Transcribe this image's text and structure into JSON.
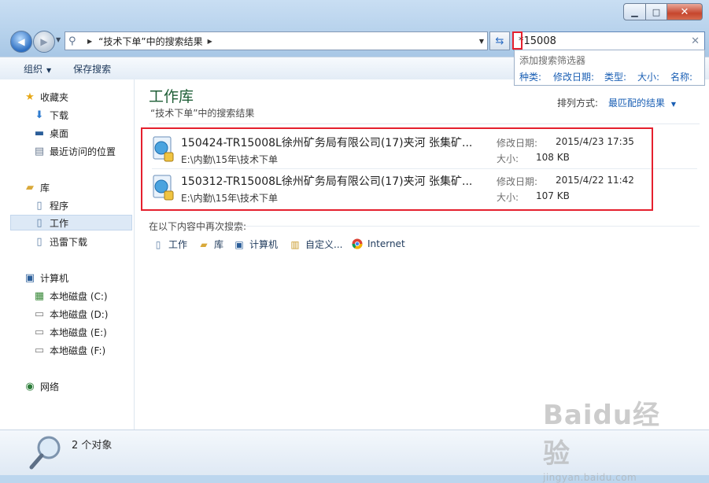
{
  "window": {
    "caption_buttons": {
      "min": "▁",
      "max": "□",
      "close": "✕"
    }
  },
  "nav": {
    "address_path": "“技术下单”中的搜索结果",
    "search_value": "*15008"
  },
  "search_suggest": {
    "title": "添加搜索筛选器",
    "filters": [
      "种类:",
      "修改日期:",
      "类型:",
      "大小:",
      "名称:"
    ]
  },
  "toolbar": {
    "organize": "组织",
    "save_search": "保存搜索"
  },
  "sidebar": {
    "favorites": {
      "label": "收藏夹",
      "items": [
        "下载",
        "桌面",
        "最近访问的位置"
      ]
    },
    "libraries": {
      "label": "库",
      "items": [
        "程序",
        "工作",
        "迅雷下载"
      ]
    },
    "computer": {
      "label": "计算机",
      "items": [
        "本地磁盘 (C:)",
        "本地磁盘 (D:)",
        "本地磁盘 (E:)",
        "本地磁盘 (F:)"
      ]
    },
    "network": {
      "label": "网络"
    }
  },
  "content": {
    "title": "工作库",
    "subtitle": "“技术下单”中的搜索结果",
    "sort_label": "排列方式:",
    "sort_value": "最匹配的结果",
    "results": [
      {
        "name": "150424-TR15008L徐州矿务局有限公司(17)夹河 张集矿...",
        "path": "E:\\内勤\\15年\\技术下单",
        "date_label": "修改日期:",
        "date": "2015/4/23 17:35",
        "size_label": "大小:",
        "size": "108 KB"
      },
      {
        "name": "150312-TR15008L徐州矿务局有限公司(17)夹河 张集矿...",
        "path": "E:\\内勤\\15年\\技术下单",
        "date_label": "修改日期:",
        "date": "2015/4/22 11:42",
        "size_label": "大小:",
        "size": "107 KB"
      }
    ],
    "search_again_label": "在以下内容中再次搜索:",
    "search_again_locations": [
      "工作",
      "库",
      "计算机",
      "自定义...",
      "Internet"
    ]
  },
  "status": {
    "count": "2 个对象"
  },
  "watermark": {
    "brand": "Baidu经验",
    "url": "jingyan.baidu.com"
  },
  "colors": {
    "highlight_red": "#e5202e",
    "link_blue": "#1a5fb4",
    "title_green": "#1e5e36"
  }
}
